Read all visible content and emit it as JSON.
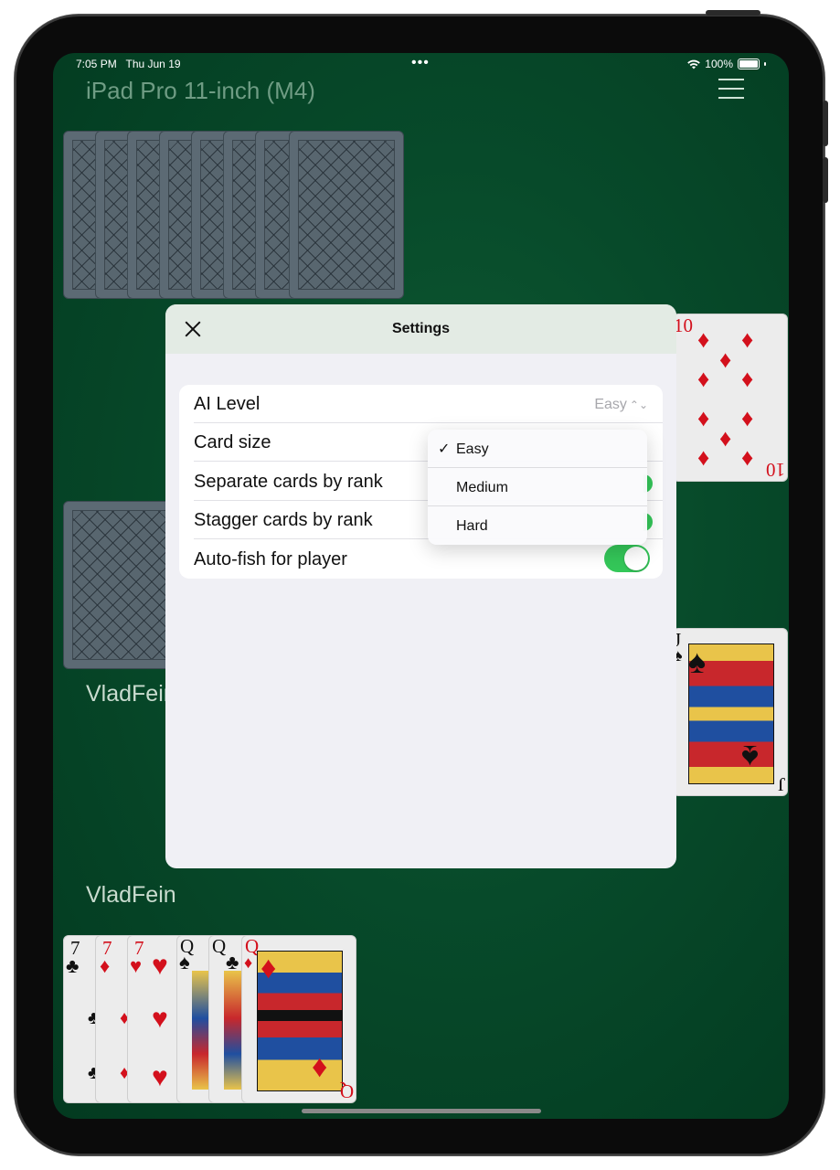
{
  "status_bar": {
    "time": "7:05 PM",
    "date": "Thu Jun 19",
    "dots": "•••",
    "battery": "100%"
  },
  "device_title": "iPad Pro 11-inch (M4)",
  "players": {
    "opponent_label": "VladFein",
    "player_label": "VladFein"
  },
  "cards": {
    "right_top": {
      "rank": "10",
      "suit": "♦"
    },
    "right_bottom": {
      "rank": "J",
      "suit": "♠"
    },
    "hand": [
      {
        "rank": "7",
        "suit": "♣"
      },
      {
        "rank": "7",
        "suit": "♦"
      },
      {
        "rank": "7",
        "suit": "♥"
      },
      {
        "rank": "Q",
        "suit": "♠"
      },
      {
        "rank": "Q",
        "suit": "♣"
      },
      {
        "rank": "Q",
        "suit": "♦"
      }
    ]
  },
  "settings": {
    "title": "Settings",
    "rows": [
      {
        "label": "AI Level",
        "value": "Easy"
      },
      {
        "label": "Card size"
      },
      {
        "label": "Separate cards by rank"
      },
      {
        "label": "Stagger cards by rank"
      },
      {
        "label": "Auto-fish for player",
        "toggle": true
      }
    ],
    "dropdown": {
      "options": [
        {
          "label": "Easy",
          "selected": true
        },
        {
          "label": "Medium"
        },
        {
          "label": "Hard"
        }
      ],
      "check": "✓"
    }
  },
  "colors": {
    "table_green": "#074a2a",
    "toggle_on": "#34c759",
    "red_suit": "#d3101c"
  }
}
